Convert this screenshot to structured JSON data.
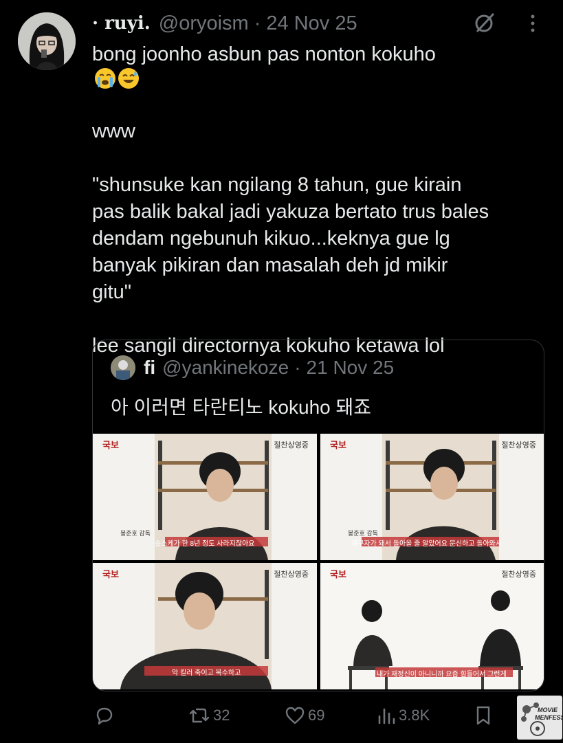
{
  "tweet": {
    "display_name": "· ruyi.",
    "handle": "@oryoism",
    "separator": "·",
    "date": "24 Nov 25",
    "line1": "bong joonho asbun pas nonton kokuho",
    "line1_end": "www",
    "quote_text": "\"shunsuke kan ngilang 8 tahun, gue kirain\npas balik bakal jadi yakuza bertato trus bales\ndendam ngebunuh kikuo...keknya gue lg\nbanyak pikiran dan masalah deh jd mikir\ngitu\"",
    "last_line": "lee sangil directornya kokuho ketawa lol"
  },
  "quoted": {
    "name": "fi",
    "handle": "@yankinekoze",
    "separator": "·",
    "date": "21 Nov 25",
    "text": "아 이러면 타란티노 kokuho 돼죠",
    "frames": [
      {
        "logo": "국보",
        "channel": "절찬상영중",
        "name_tag": "봉준호 감독",
        "subtitle": "슜스케가 한 8년 정도 사라지잖아요"
      },
      {
        "logo": "국보",
        "channel": "절찬상영중",
        "name_tag": "봉준호 감독",
        "subtitle": "야쿠자가 돼서 돌아올 줄 알았어요 문신하고 돌아와서"
      },
      {
        "logo": "국보",
        "channel": "절찬상영중",
        "name_tag": "",
        "subtitle": "악 킬러 죽이고 복수하고"
      },
      {
        "logo": "국보",
        "channel": "절찬상영중",
        "name_tag": "",
        "subtitle": "내가 재정신이 아니니까 요즘 힘들어서 그런게"
      }
    ]
  },
  "actions": {
    "replies": "",
    "retweets": "32",
    "likes": "69",
    "views": "3.8K"
  },
  "watermark": {
    "line1": "MOVIE",
    "line2": "MENFESS"
  },
  "colors": {
    "background": "#000000",
    "text": "#e7e9ea",
    "muted": "#71767b",
    "border": "#2f3336",
    "subtitle_bar": "#c43a3a"
  }
}
